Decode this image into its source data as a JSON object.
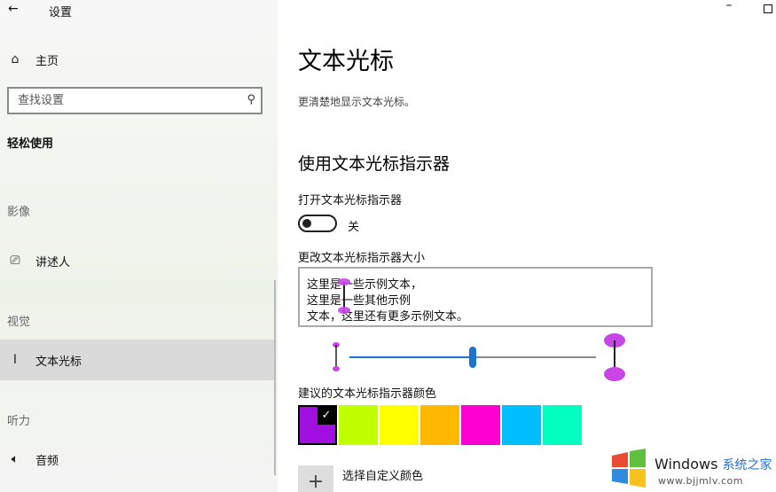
{
  "window": {
    "back": "←",
    "title": "设置",
    "minimize": "–"
  },
  "sidebar": {
    "home": "主页",
    "search_placeholder": "查找设置",
    "section": "轻松使用",
    "groups": {
      "vision_partial": "影像",
      "vision": "视觉",
      "hearing": "听力"
    },
    "items": [
      {
        "label": "讲述人",
        "icon": "narrator-icon"
      },
      {
        "label": "文本光标",
        "icon": "text-cursor-icon",
        "selected": true
      },
      {
        "label": "音频",
        "icon": "speaker-icon"
      }
    ]
  },
  "main": {
    "title": "文本光标",
    "description": "更清楚地显示文本光标。",
    "indicator_heading": "使用文本光标指示器",
    "toggle_label": "打开文本光标指示器",
    "toggle_state": "关",
    "toggle_on": false,
    "size_label": "更改文本光标指示器大小",
    "preview_lines": [
      "这里是一些示例文本，",
      "这里是一些其他示例",
      "文本，这里还有更多示例文本。"
    ],
    "size_slider_value": 0.5,
    "colors_label": "建议的文本光标指示器颜色",
    "colors": [
      "#a00fe0",
      "#bfff00",
      "#ffff00",
      "#ffb900",
      "#ff00d0",
      "#00bfff",
      "#00ffc0"
    ],
    "selected_color_index": 0,
    "custom_color_label": "选择自定义颜色",
    "custom_color_icon": "+"
  },
  "watermark": {
    "brand": "Windows",
    "brand_cn": "系统之家",
    "url": "www.bjjmlv.com"
  }
}
